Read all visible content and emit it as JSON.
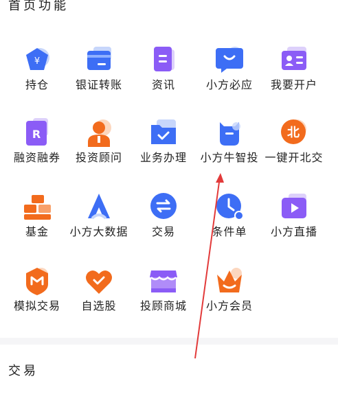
{
  "sections": {
    "top_title": "首页功能",
    "trade_title": "交易"
  },
  "items": [
    {
      "label": "持仓"
    },
    {
      "label": "银证转账"
    },
    {
      "label": "资讯"
    },
    {
      "label": "小方必应"
    },
    {
      "label": "我要开户"
    },
    {
      "label": "融资融券"
    },
    {
      "label": "投资顾问"
    },
    {
      "label": "业务办理"
    },
    {
      "label": "小方牛智投"
    },
    {
      "label": "一键开北交"
    },
    {
      "label": "基金"
    },
    {
      "label": "小方大数据"
    },
    {
      "label": "交易"
    },
    {
      "label": "条件单"
    },
    {
      "label": "小方直播"
    },
    {
      "label": "模拟交易"
    },
    {
      "label": "自选股"
    },
    {
      "label": "投顾商城"
    },
    {
      "label": "小方会员"
    }
  ],
  "colors": {
    "blue": "#3d6ef5",
    "purple": "#8b5cf6",
    "orange": "#f26b1d",
    "annotation_red": "#e23a3a"
  }
}
